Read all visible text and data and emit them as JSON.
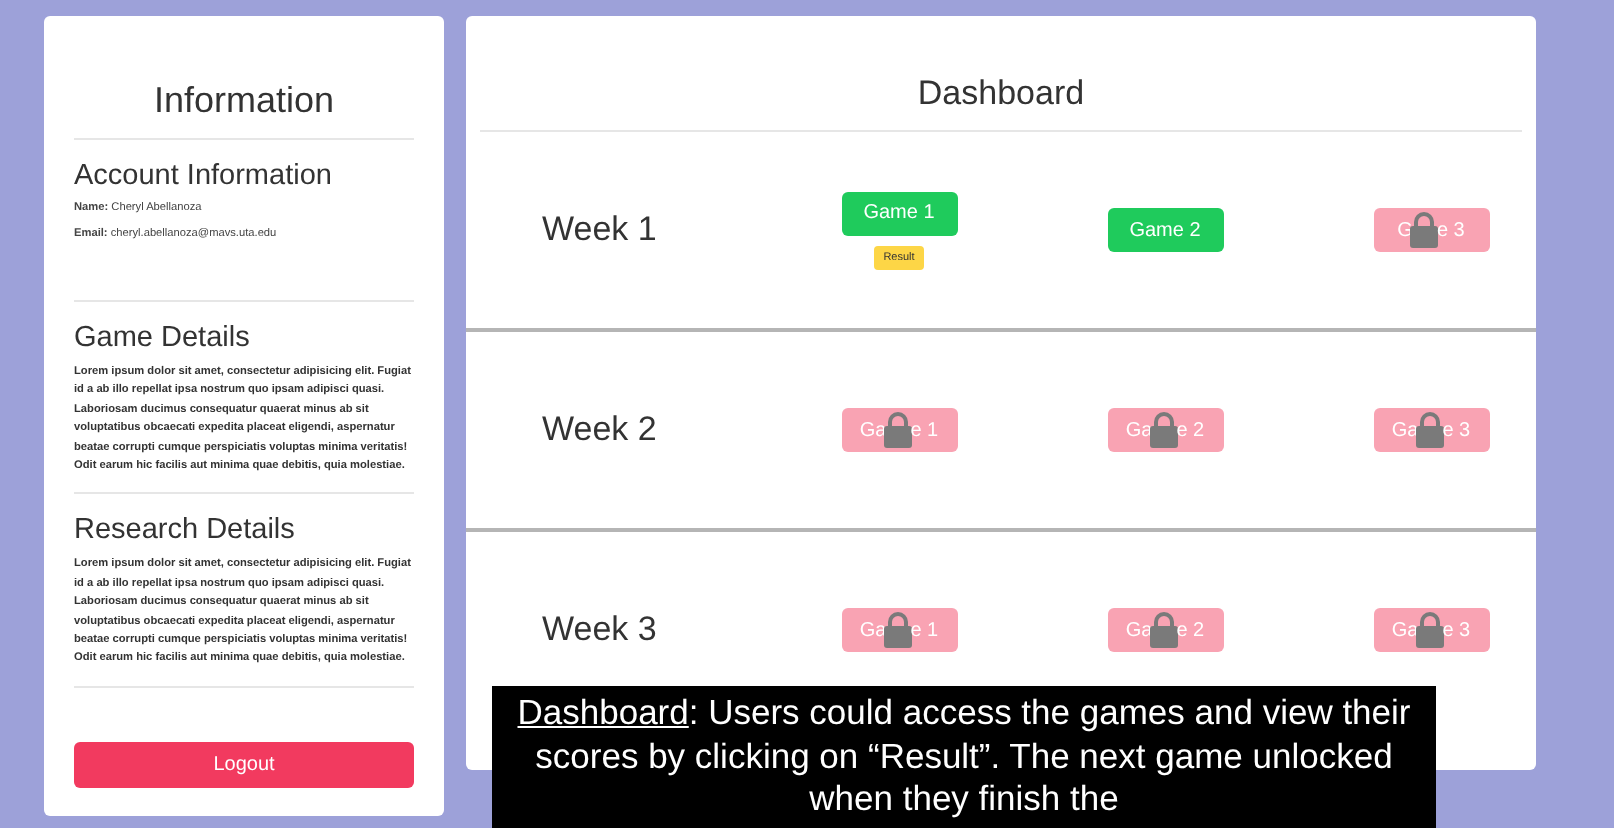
{
  "sidebar": {
    "title": "Information",
    "sections": [
      {
        "heading": "Account Information",
        "fields": [
          {
            "label": "Name:",
            "value": "Cheryl Abellanoza"
          },
          {
            "label": "Email:",
            "value": "cheryl.abellanoza@mavs.uta.edu"
          }
        ]
      },
      {
        "heading": "Game Details",
        "body": "Lorem ipsum dolor sit amet, consectetur adipisicing elit. Fugiat id a ab illo repellat ipsa nostrum quo ipsam adipisci quasi. Laboriosam ducimus consequatur quaerat minus ab sit voluptatibus obcaecati expedita placeat eligendi, aspernatur beatae corrupti cumque perspiciatis voluptas minima veritatis! Odit earum hic facilis aut minima quae debitis, quia molestiae."
      },
      {
        "heading": "Research Details",
        "body": "Lorem ipsum dolor sit amet, consectetur adipisicing elit. Fugiat id a ab illo repellat ipsa nostrum quo ipsam adipisci quasi. Laboriosam ducimus consequatur quaerat minus ab sit voluptatibus obcaecati expedita placeat eligendi, aspernatur beatae corrupti cumque perspiciatis voluptas minima veritatis! Odit earum hic facilis aut minima quae debitis, quia molestiae."
      }
    ],
    "logout": "Logout"
  },
  "dashboard": {
    "title": "Dashboard",
    "weeks": [
      {
        "label": "Week 1",
        "games": [
          {
            "kind": "open",
            "label": "Game 1",
            "result": "Result"
          },
          {
            "kind": "open",
            "label": "Game 2"
          },
          {
            "kind": "locked",
            "label_start": "G",
            "label_end": "e 3"
          }
        ]
      },
      {
        "label": "Week 2",
        "games": [
          {
            "kind": "locked",
            "label_start": "Ga",
            "label_end": "e 1"
          },
          {
            "kind": "locked",
            "label_start": "Ga",
            "label_end": "e 2"
          },
          {
            "kind": "locked",
            "label_start": "Ga",
            "label_end": "e 3"
          }
        ]
      },
      {
        "label": "Week 3",
        "games": [
          {
            "kind": "locked",
            "label_start": "Ga",
            "label_end": "e 1"
          },
          {
            "kind": "locked",
            "label_start": "Ga",
            "label_end": "e 2"
          },
          {
            "kind": "locked",
            "label_start": "Ga",
            "label_end": "e 3"
          }
        ]
      }
    ]
  },
  "caption": {
    "term": "Dashboard",
    "text": ": Users could access the games and view their scores by clicking on “Result”. The next game unlocked when they finish the"
  }
}
